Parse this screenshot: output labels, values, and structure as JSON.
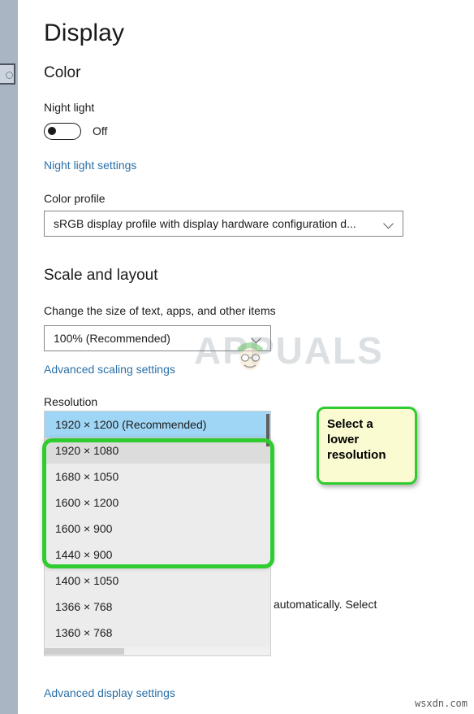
{
  "window": {
    "page_title": "Display"
  },
  "nav": {
    "search_icon": "search-icon"
  },
  "sections": {
    "color": {
      "heading": "Color",
      "night_light": {
        "label": "Night light",
        "toggle_state": "Off",
        "link": "Night light settings"
      },
      "color_profile": {
        "label": "Color profile",
        "value": "sRGB display profile with display hardware configuration d...",
        "chevron_icon": "chevron-down-icon"
      }
    },
    "scale_and_layout": {
      "heading": "Scale and layout",
      "change_size": {
        "label": "Change the size of text, apps, and other items",
        "value": "100% (Recommended)",
        "chevron_icon": "chevron-down-icon"
      },
      "advanced_scaling_link": "Advanced scaling settings",
      "resolution": {
        "label": "Resolution",
        "options": [
          {
            "text": "1920 × 1200 (Recommended)",
            "state": "selected"
          },
          {
            "text": "1920 × 1080",
            "state": "hover"
          },
          {
            "text": "1680 × 1050",
            "state": "normal"
          },
          {
            "text": "1600 × 1200",
            "state": "normal"
          },
          {
            "text": "1600 × 900",
            "state": "normal"
          },
          {
            "text": "1440 × 900",
            "state": "normal"
          },
          {
            "text": "1400 × 1050",
            "state": "normal"
          },
          {
            "text": "1366 × 768",
            "state": "normal"
          },
          {
            "text": "1360 × 768",
            "state": "normal"
          }
        ]
      },
      "obscured_text": "automatically. Select",
      "advanced_display_link": "Advanced display settings"
    }
  },
  "annotations": {
    "callout": {
      "text": "Select a lower resolution",
      "background_color": "#fbfbd2",
      "border_color": "#2ecc2e"
    },
    "highlight_box": {
      "border_color": "#2ecc2e"
    }
  },
  "watermarks": {
    "center": "APPUALS",
    "bottom_right": "wsxdn.com"
  },
  "colors": {
    "accent_link": "#2a6fa8",
    "selection": "#9fd6f5",
    "annotation_green": "#2ecc2e",
    "nav_strip": "#a9b5c2"
  }
}
